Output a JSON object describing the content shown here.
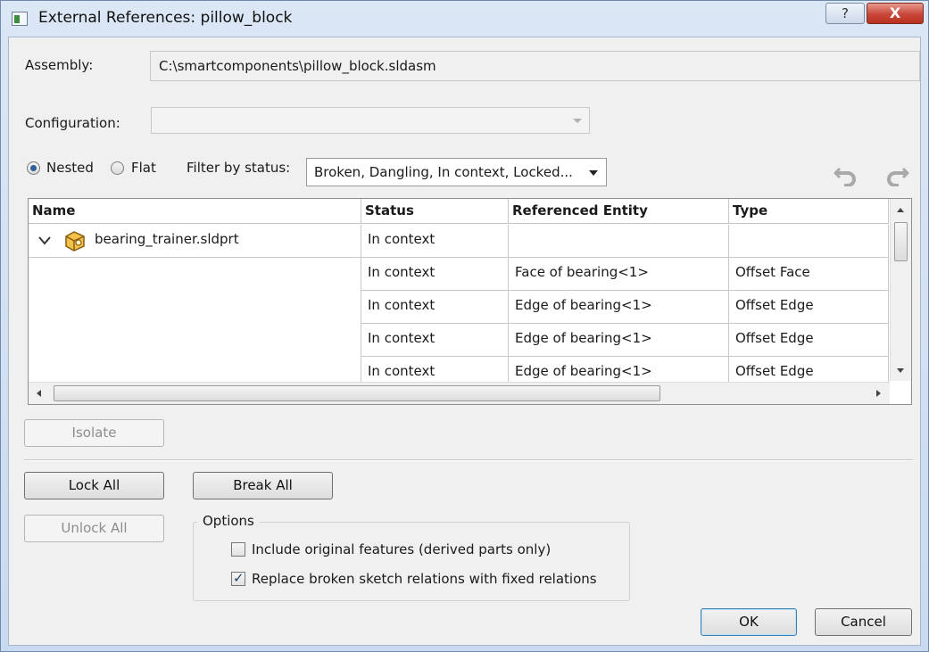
{
  "window": {
    "title": "External References: pillow_block",
    "help_label": "?",
    "close_label": "X"
  },
  "assembly": {
    "label": "Assembly:",
    "value": "C:\\smartcomponents\\pillow_block.sldasm"
  },
  "configuration": {
    "label": "Configuration:",
    "value": ""
  },
  "view_mode": {
    "nested_label": "Nested",
    "flat_label": "Flat",
    "selected": "Nested"
  },
  "filter": {
    "label": "Filter by status:",
    "value": "Broken, Dangling, In context, Locked..."
  },
  "table": {
    "columns": [
      "Name",
      "Status",
      "Referenced Entity",
      "Type"
    ],
    "rows": [
      {
        "name": "bearing_trainer.sldprt",
        "status": "In context",
        "entity": "",
        "type": ""
      },
      {
        "name": "",
        "status": "In context",
        "entity": "Face of bearing<1>",
        "type": "Offset Face"
      },
      {
        "name": "",
        "status": "In context",
        "entity": "Edge of bearing<1>",
        "type": "Offset Edge"
      },
      {
        "name": "",
        "status": "In context",
        "entity": "Edge of bearing<1>",
        "type": "Offset Edge"
      },
      {
        "name": "",
        "status": "In context",
        "entity": "Edge of bearing<1>",
        "type": "Offset Edge"
      }
    ]
  },
  "buttons": {
    "isolate": "Isolate",
    "lock_all": "Lock All",
    "break_all": "Break All",
    "unlock_all": "Unlock All",
    "ok": "OK",
    "cancel": "Cancel"
  },
  "options": {
    "title": "Options",
    "include_original": {
      "label": "Include original features (derived parts only)",
      "checked": false
    },
    "replace_broken": {
      "label": "Replace broken sketch relations with fixed relations",
      "checked": true
    }
  },
  "icons": {
    "expand": "chevron-down-icon",
    "part": "part-icon",
    "undo": "undo-icon",
    "redo": "redo-icon"
  },
  "colors": {
    "default_button_border": "#3c7fb1",
    "close_button": "#c9473a"
  }
}
